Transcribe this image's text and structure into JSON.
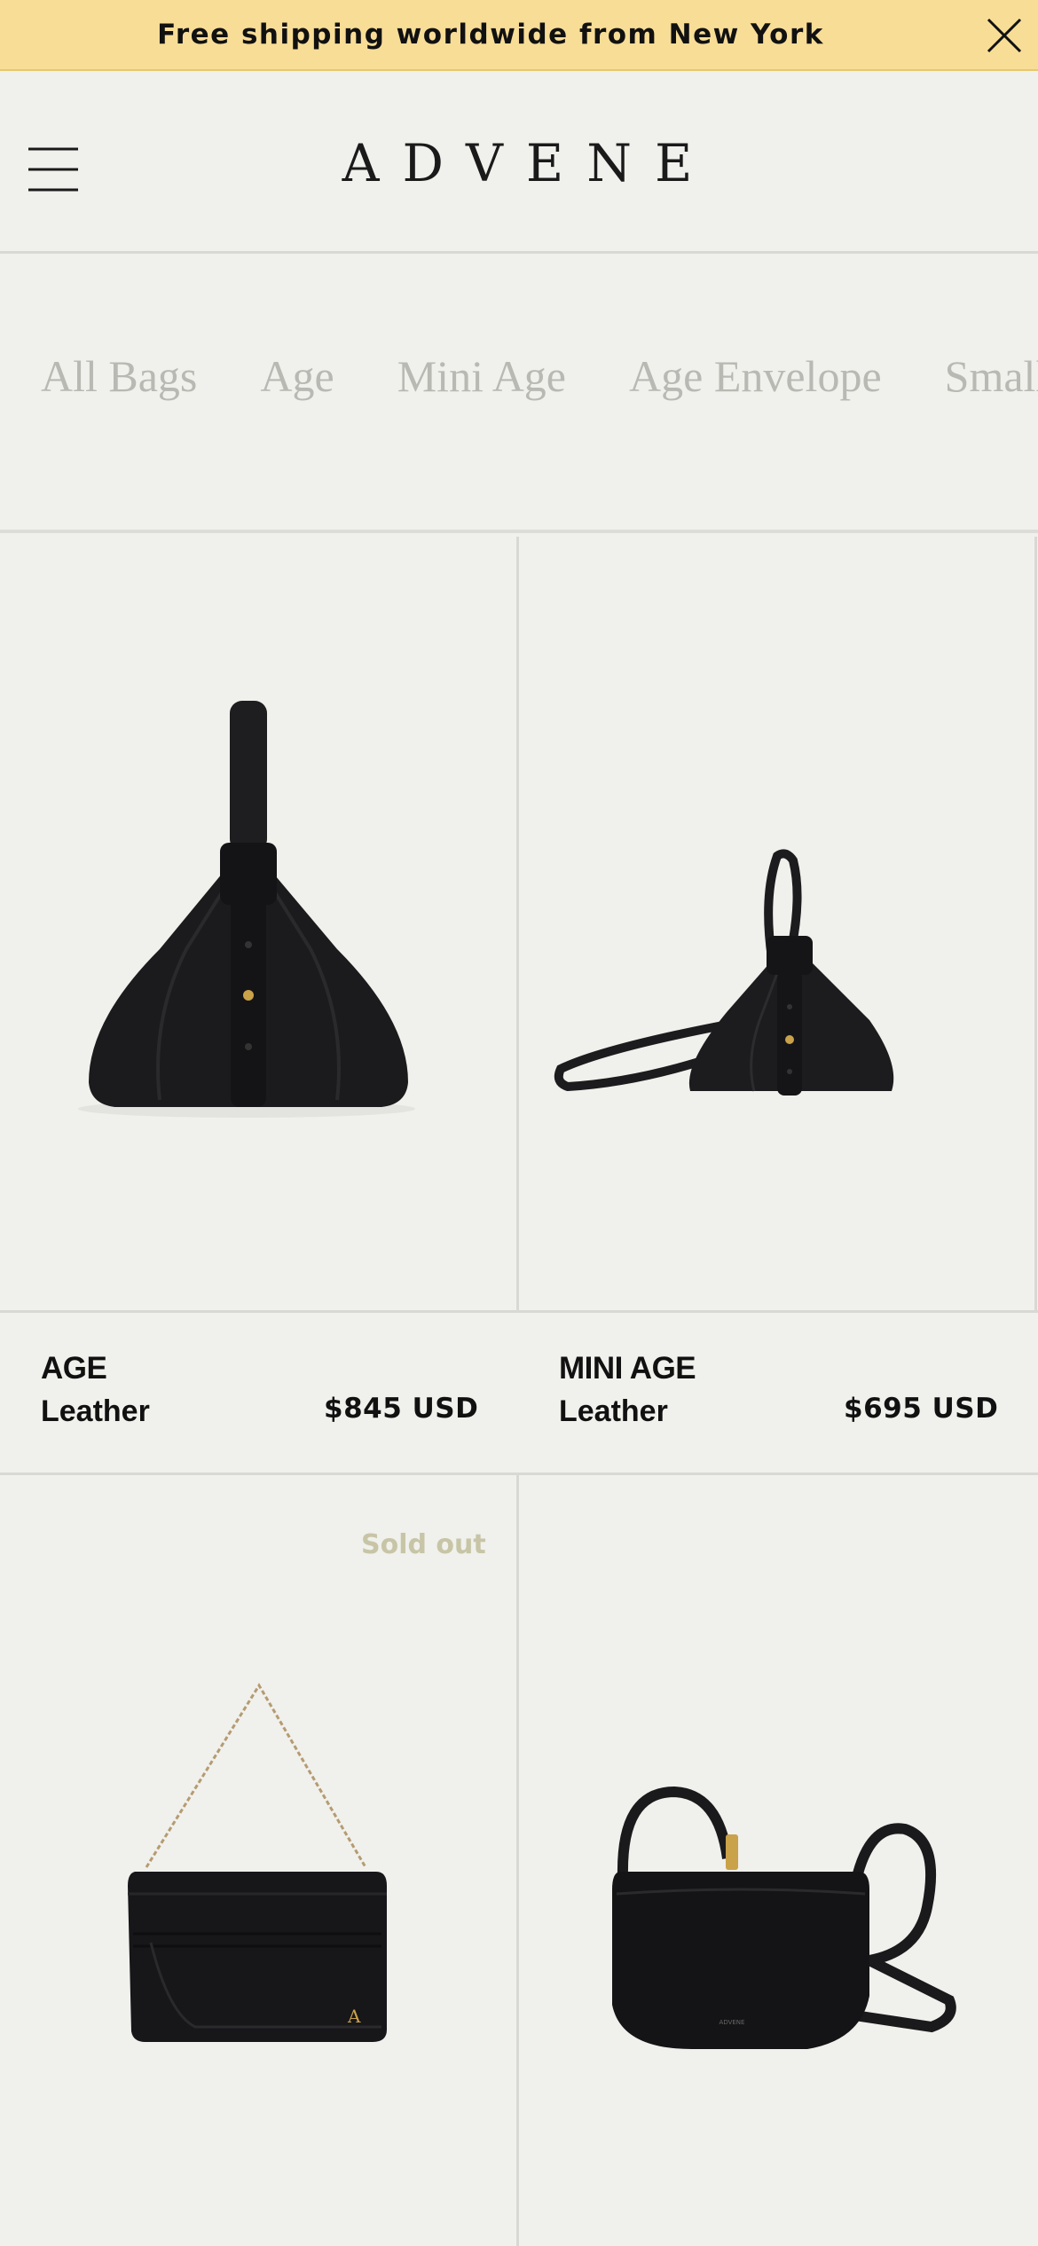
{
  "announcement": {
    "text": "Free shipping worldwide from New York",
    "close_icon": "close-icon",
    "background": "#f8dd97"
  },
  "header": {
    "menu_icon": "hamburger-menu-icon",
    "logo": "ADVENE"
  },
  "categories": [
    "All Bags",
    "Age",
    "Mini Age",
    "Age Envelope",
    "Small"
  ],
  "products": [
    {
      "name": "AGE",
      "material": "Leather",
      "price": "$845 USD",
      "badge": ""
    },
    {
      "name": "MINI AGE",
      "material": "Leather",
      "price": "$695 USD",
      "badge": ""
    },
    {
      "name": "",
      "material": "",
      "price": "",
      "badge": "Sold out"
    },
    {
      "name": "",
      "material": "",
      "price": "",
      "badge": ""
    }
  ],
  "colors": {
    "background": "#f0f0ec",
    "category_text": "#b9b9b4",
    "soldout_text": "#c7c5a6",
    "product_black": "#1b1b1d"
  }
}
